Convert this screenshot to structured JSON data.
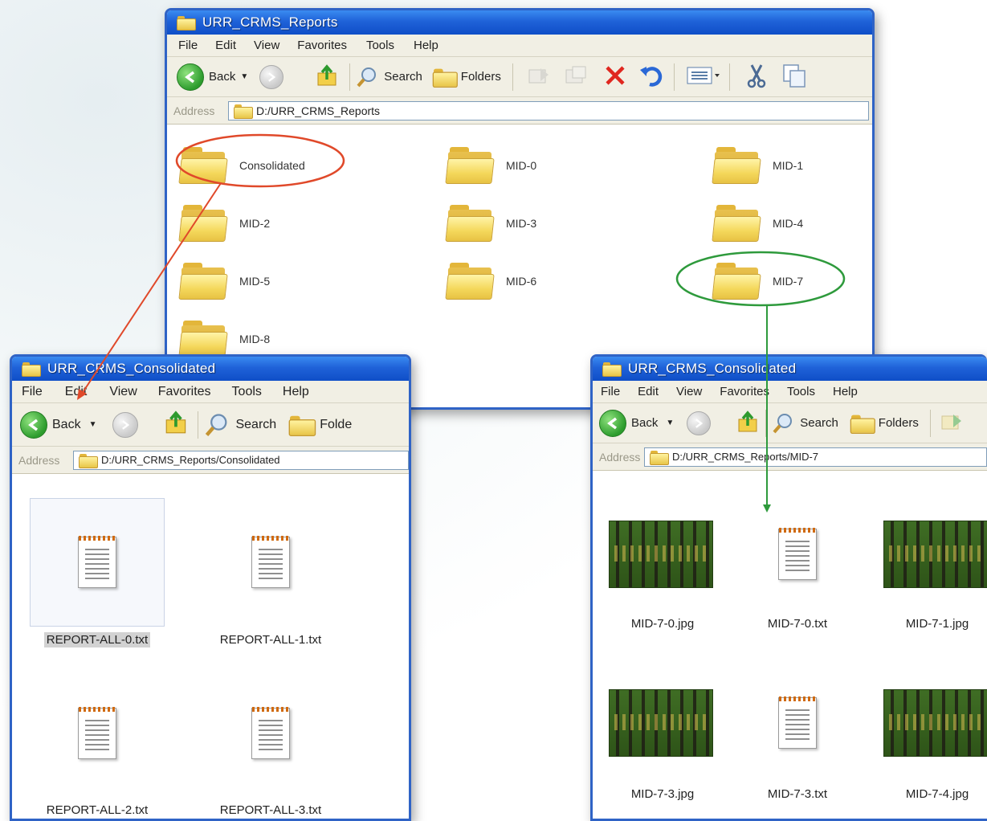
{
  "main_window": {
    "title": "URR_CRMS_Reports",
    "menu": [
      "File",
      "Edit",
      "View",
      "Favorites",
      "Tools",
      "Help"
    ],
    "toolbar": {
      "back": "Back",
      "search": "Search",
      "folders": "Folders"
    },
    "address_label": "Address",
    "address_value": "D:/URR_CRMS_Reports",
    "folders": [
      "Consolidated",
      "MID-0",
      "MID-1",
      "MID-2",
      "MID-3",
      "MID-4",
      "MID-5",
      "MID-6",
      "MID-7",
      "MID-8"
    ]
  },
  "left_window": {
    "title": "URR_CRMS_Consolidated",
    "menu": [
      "File",
      "Edit",
      "View",
      "Favorites",
      "Tools",
      "Help"
    ],
    "toolbar": {
      "back": "Back",
      "search": "Search",
      "folders": "Folde"
    },
    "address_label": "Address",
    "address_value": "D:/URR_CRMS_Reports/Consolidated",
    "files": [
      "REPORT-ALL-0.txt",
      "REPORT-ALL-1.txt",
      "REPORT-ALL-2.txt",
      "REPORT-ALL-3.txt"
    ],
    "selected_file": "REPORT-ALL-0.txt"
  },
  "right_window": {
    "title": "URR_CRMS_Consolidated",
    "menu": [
      "File",
      "Edit",
      "View",
      "Favorites",
      "Tools",
      "Help"
    ],
    "toolbar": {
      "back": "Back",
      "search": "Search",
      "folders": "Folders"
    },
    "address_label": "Address",
    "address_value": "D:/URR_CRMS_Reports/MID-7",
    "files": [
      "MID-7-0.jpg",
      "MID-7-0.txt",
      "MID-7-1.jpg",
      "MID-7-3.jpg",
      "MID-7-3.txt",
      "MID-7-4.jpg"
    ]
  },
  "annotations": {
    "consolidated_link_color": "#e0492a",
    "mid7_link_color": "#2e9a3c"
  }
}
